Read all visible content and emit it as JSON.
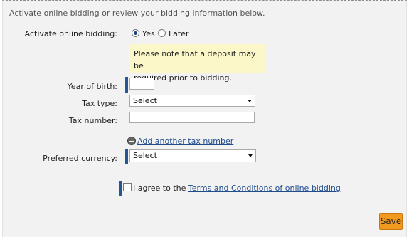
{
  "intro": "Activate online bidding or review your bidding information below.",
  "activate": {
    "label": "Activate online bidding:",
    "options": [
      {
        "label": "Yes",
        "checked": true
      },
      {
        "label": "Later",
        "checked": false
      }
    ]
  },
  "notice": {
    "line1": "Please note that a deposit may be",
    "line2": "required prior to bidding."
  },
  "year_of_birth": {
    "label": "Year of birth:",
    "value": ""
  },
  "tax_type": {
    "label": "Tax type:",
    "selected": "Select"
  },
  "tax_number": {
    "label": "Tax number:",
    "value": ""
  },
  "add_tax": {
    "label": "Add another tax number"
  },
  "currency": {
    "label": "Preferred currency:",
    "selected": "Select"
  },
  "agree": {
    "prefix": "I agree to the ",
    "link": "Terms and Conditions of online bidding"
  },
  "save_label": "Save",
  "colors": {
    "panel_bg": "#f3f2f2",
    "required_bar": "#24568f",
    "notice_bg": "#fbf7c8",
    "link": "#1f4d8e",
    "save_button": "#f29a1f"
  }
}
